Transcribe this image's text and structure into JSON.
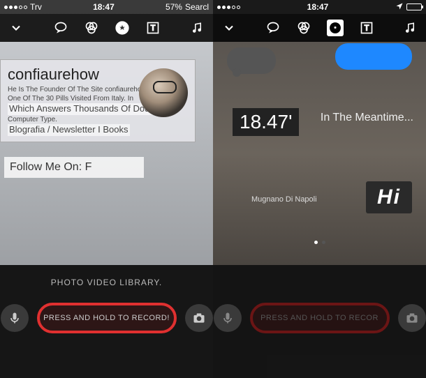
{
  "left": {
    "status": {
      "carrier": "Trv",
      "time": "18:47",
      "battery_text": "57%",
      "search": "Searcl"
    },
    "card": {
      "title": "confiaurehow",
      "line1": "He Is The Founder Of The Site confiaurehow.com.",
      "line2": "One Of The 30 Pills Visited From Italy. In",
      "line3": "Which Answers Thousands Of Doubts",
      "line4": "Computer Type.",
      "line5": "Blografia / Newsletter I Books"
    },
    "follow": "Follow Me On: F",
    "library_label": "PHOTO VIDEO LIBRARY.",
    "record_label": "PRESS AND HOLD TO RECORD!"
  },
  "right": {
    "status": {
      "time": "18:47"
    },
    "bubble_blue": "",
    "time_overlay": "18.47'",
    "meantime": "In The Meantime...",
    "location": "Mugnano Di Napoli",
    "hi": "Hi",
    "record_label": "PRESS AND HOLD TO RECOR"
  }
}
